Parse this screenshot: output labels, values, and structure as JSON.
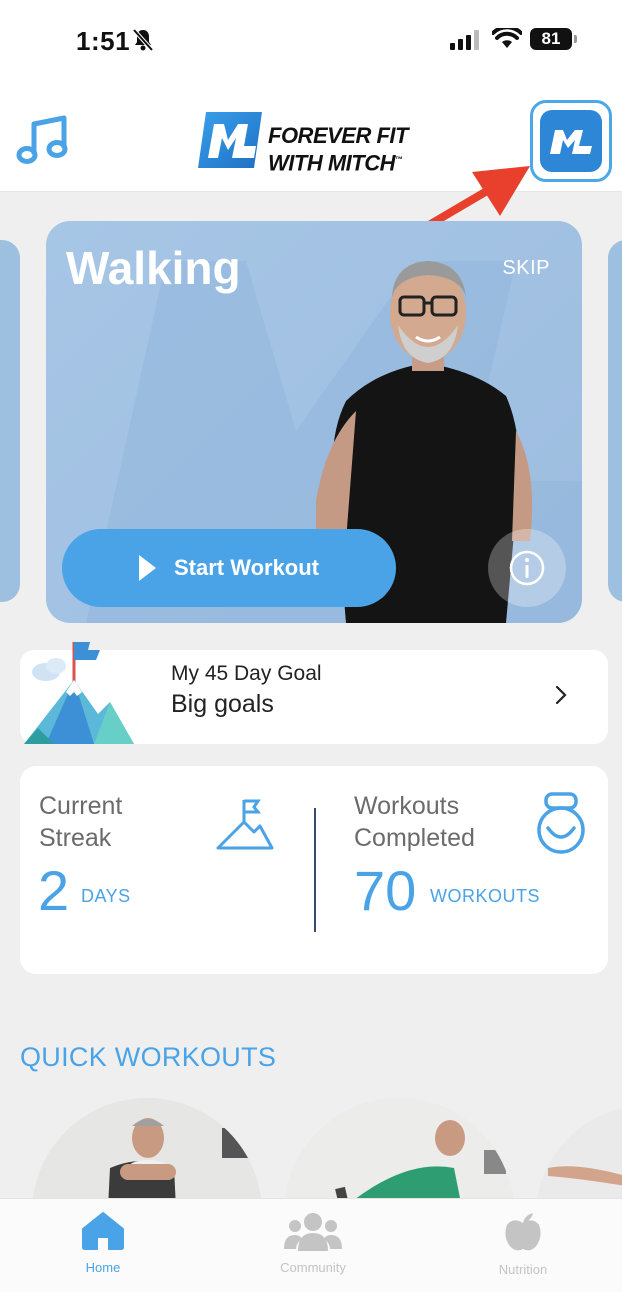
{
  "status_bar": {
    "time": "1:51",
    "battery": "81"
  },
  "header": {
    "logo_line1": "FOREVER FIT",
    "logo_line2": "WITH MITCH",
    "logo_tm": "™"
  },
  "featured": {
    "title": "Walking",
    "skip_label": "SKIP",
    "start_label": "Start Workout"
  },
  "goal": {
    "subtitle": "My 45 Day Goal",
    "title": "Big goals"
  },
  "stats": {
    "streak_label_line1": "Current",
    "streak_label_line2": "Streak",
    "streak_value": "2",
    "streak_unit": "DAYS",
    "workouts_label_line1": "Workouts",
    "workouts_label_line2": "Completed",
    "workouts_value": "70",
    "workouts_unit": "WORKOUTS"
  },
  "quick_workouts": {
    "title": "QUICK WORKOUTS"
  },
  "tabs": [
    {
      "label": "Home",
      "icon": "home-icon",
      "active": true
    },
    {
      "label": "Community",
      "icon": "community-icon",
      "active": false
    },
    {
      "label": "Nutrition",
      "icon": "apple-icon",
      "active": false
    }
  ],
  "colors": {
    "accent": "#4aa3e6",
    "brand": "#2e86d6",
    "arrow": "#e8402c",
    "tab_inactive": "#c4c4c4"
  }
}
